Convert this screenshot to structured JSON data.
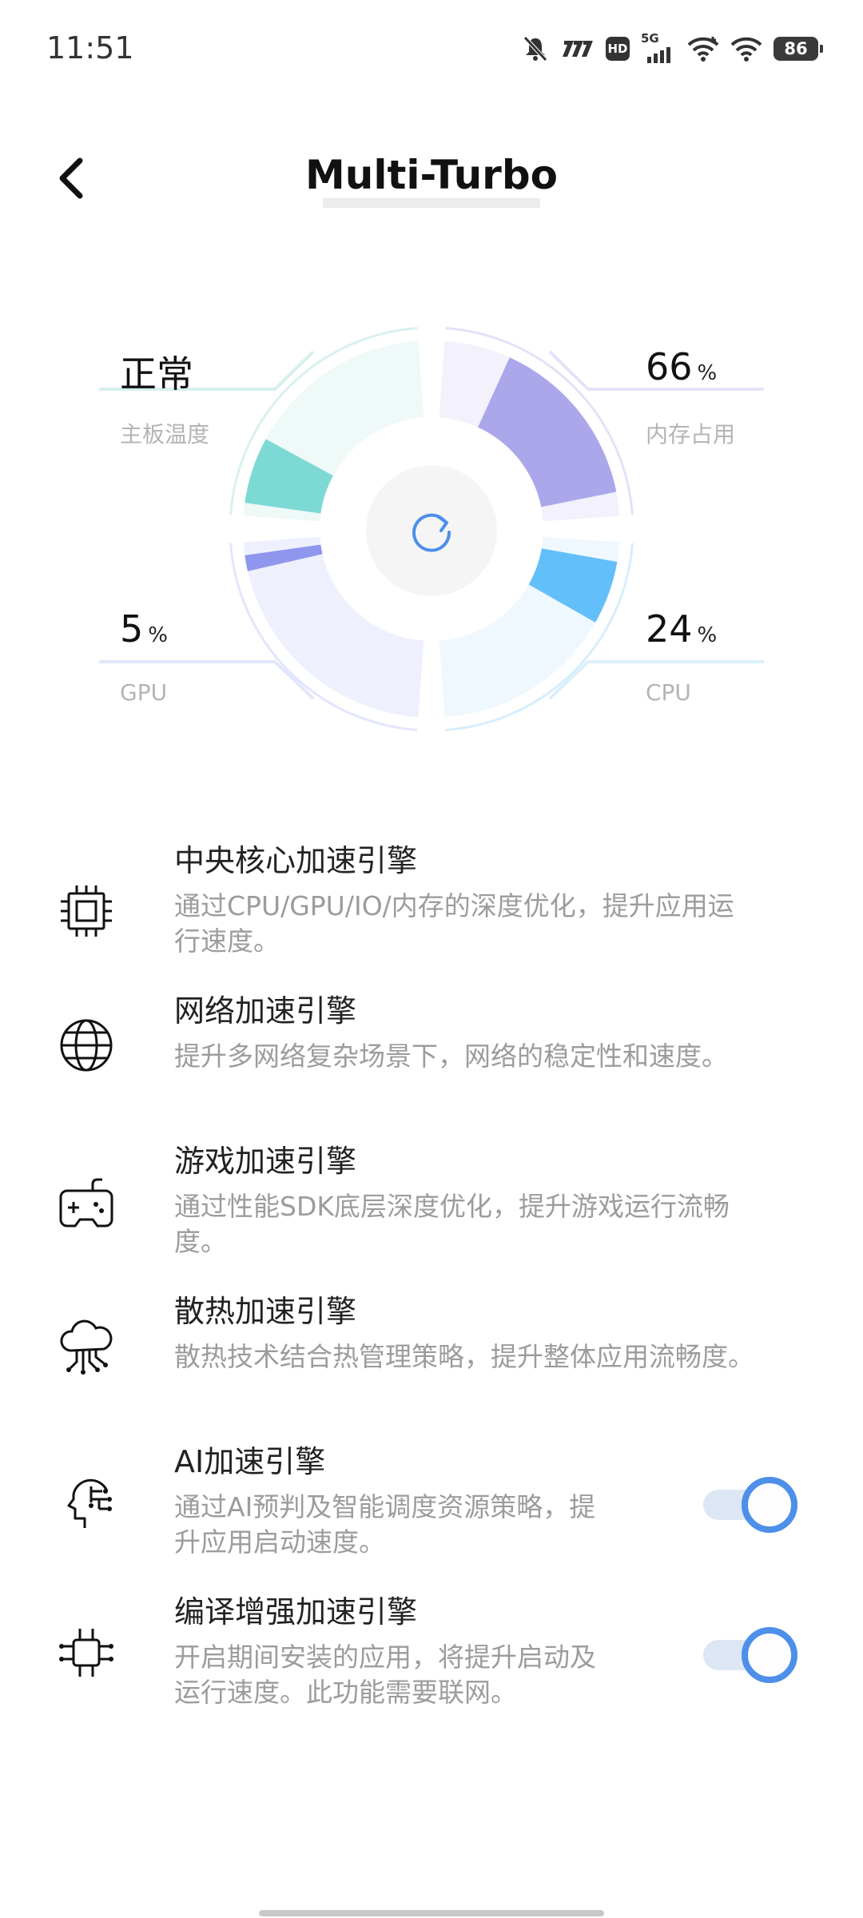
{
  "status_bar": {
    "time": "11:51",
    "network_label": "5G",
    "hd_label": "HD",
    "battery": "86",
    "icons": [
      "mute-icon",
      "carrier-icon",
      "hd-icon",
      "signal-5g-icon",
      "wifi-plus-icon",
      "wifi-icon",
      "battery-icon"
    ]
  },
  "header": {
    "title": "Multi-Turbo",
    "back_icon": "chevron-left-icon"
  },
  "dashboard": {
    "board_temp": {
      "value": "正常",
      "label": "主板温度"
    },
    "memory": {
      "value": "66",
      "unit": "%",
      "label": "内存占用"
    },
    "gpu": {
      "value": "5",
      "unit": "%",
      "label": "GPU"
    },
    "cpu": {
      "value": "24",
      "unit": "%",
      "label": "CPU"
    },
    "refresh_icon": "refresh-icon",
    "colors": {
      "temp": "#7dd9d4",
      "memory": "#aba7ea",
      "gpu": "#8e96ee",
      "cpu": "#62bff9",
      "temp_bg": "#eef9f8",
      "memory_bg": "#f2f1fc",
      "gpu_bg": "#eef1fd",
      "cpu_bg": "#eef8fe"
    }
  },
  "engines": [
    {
      "title": "中央核心加速引擎",
      "desc_line1": "通过CPU/GPU/IO/内存的深度优化，提升应用运",
      "desc_line2": "行速度。",
      "icon": "chip-icon",
      "toggle": false
    },
    {
      "title": "网络加速引擎",
      "desc_line1": "提升多网络复杂场景下，网络的稳定性和速度。",
      "desc_line2": "",
      "icon": "globe-icon",
      "toggle": false
    },
    {
      "title": "游戏加速引擎",
      "desc_line1": "通过性能SDK底层深度优化，提升游戏运行流畅",
      "desc_line2": "度。",
      "icon": "gamepad-icon",
      "toggle": false
    },
    {
      "title": "散热加速引擎",
      "desc_line1": "散热技术结合热管理策略，提升整体应用流畅度。",
      "desc_line2": "",
      "icon": "cloud-circuit-icon",
      "toggle": false
    },
    {
      "title": "AI加速引擎",
      "desc_line1": "通过AI预判及智能调度资源策略，提",
      "desc_line2": "升应用启动速度。",
      "icon": "ai-head-icon",
      "toggle": true
    },
    {
      "title": "编译增强加速引擎",
      "desc_line1": "开启期间安装的应用，将提升启动及",
      "desc_line2": "运行速度。此功能需要联网。",
      "icon": "compile-chip-icon",
      "toggle": true
    }
  ],
  "accent_color": "#4d8fe9"
}
